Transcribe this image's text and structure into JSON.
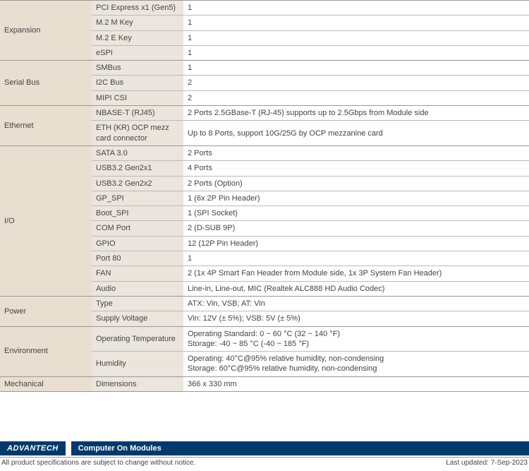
{
  "spec_groups": [
    {
      "category": "Expansion",
      "rows": [
        {
          "sub": "PCI Express x1 (Gen5)",
          "val": "1"
        },
        {
          "sub": "M.2 M Key",
          "val": "1"
        },
        {
          "sub": "M.2 E Key",
          "val": "1"
        },
        {
          "sub": "eSPI",
          "val": "1"
        }
      ]
    },
    {
      "category": "Serial Bus",
      "rows": [
        {
          "sub": "SMBus",
          "val": "1"
        },
        {
          "sub": "I2C Bus",
          "val": "2"
        },
        {
          "sub": "MIPI CSI",
          "val": "2"
        }
      ]
    },
    {
      "category": "Ethernet",
      "rows": [
        {
          "sub": "NBASE-T (RJ45)",
          "val": "2 Ports 2.5GBase-T (RJ-45) supports up to 2.5Gbps from Module side"
        },
        {
          "sub": "ETH (KR) OCP mezz card connector",
          "val": "Up to 8 Ports, support 10G/25G by OCP mezzanine card"
        }
      ]
    },
    {
      "category": "I/O",
      "rows": [
        {
          "sub": "SATA 3.0",
          "val": "2 Ports"
        },
        {
          "sub": "USB3.2 Gen2x1",
          "val": "4 Ports"
        },
        {
          "sub": "USB3.2 Gen2x2",
          "val": "2 Ports (Option)"
        },
        {
          "sub": "GP_SPI",
          "val": "1 (6x 2P Pin Header)"
        },
        {
          "sub": "Boot_SPI",
          "val": "1 (SPI Socket)"
        },
        {
          "sub": "COM Port",
          "val": "2 (D-SUB 9P)"
        },
        {
          "sub": "GPIO",
          "val": "12 (12P Pin Header)"
        },
        {
          "sub": "Port 80",
          "val": "1"
        },
        {
          "sub": "FAN",
          "val": "2 (1x 4P Smart Fan Header from Module side, 1x 3P System Fan Header)"
        },
        {
          "sub": "Audio",
          "val": "Line-in, Line-out, MIC (Realtek ALC888 HD Audio Codec)"
        }
      ]
    },
    {
      "category": "Power",
      "rows": [
        {
          "sub": "Type",
          "val": "ATX: Vin, VSB; AT: Vin"
        },
        {
          "sub": "Supply Voltage",
          "val": "Vin: 12V (± 5%); VSB: 5V (± 5%)"
        }
      ]
    },
    {
      "category": "Environment",
      "rows": [
        {
          "sub": "Operating Temperature",
          "val": "Operating Standard: 0 ~ 60 °C (32 ~ 140 °F)\nStorage: -40 ~ 85 °C (-40 ~ 185 °F)"
        },
        {
          "sub": "Humidity",
          "val": "Operating: 40°C@95% relative humidity, non-condensing\nStorage: 60°C@95% relative humidity, non-condensing"
        }
      ]
    },
    {
      "category": "Mechanical",
      "rows": [
        {
          "sub": "Dimensions",
          "val": "366 x 330 mm"
        }
      ]
    }
  ],
  "footer": {
    "brand": "ADVANTECH",
    "subtitle": "Computer On Modules",
    "disclaimer": "All product specifications are subject to change without notice.",
    "updated": "Last updated: 7-Sep-2023"
  }
}
